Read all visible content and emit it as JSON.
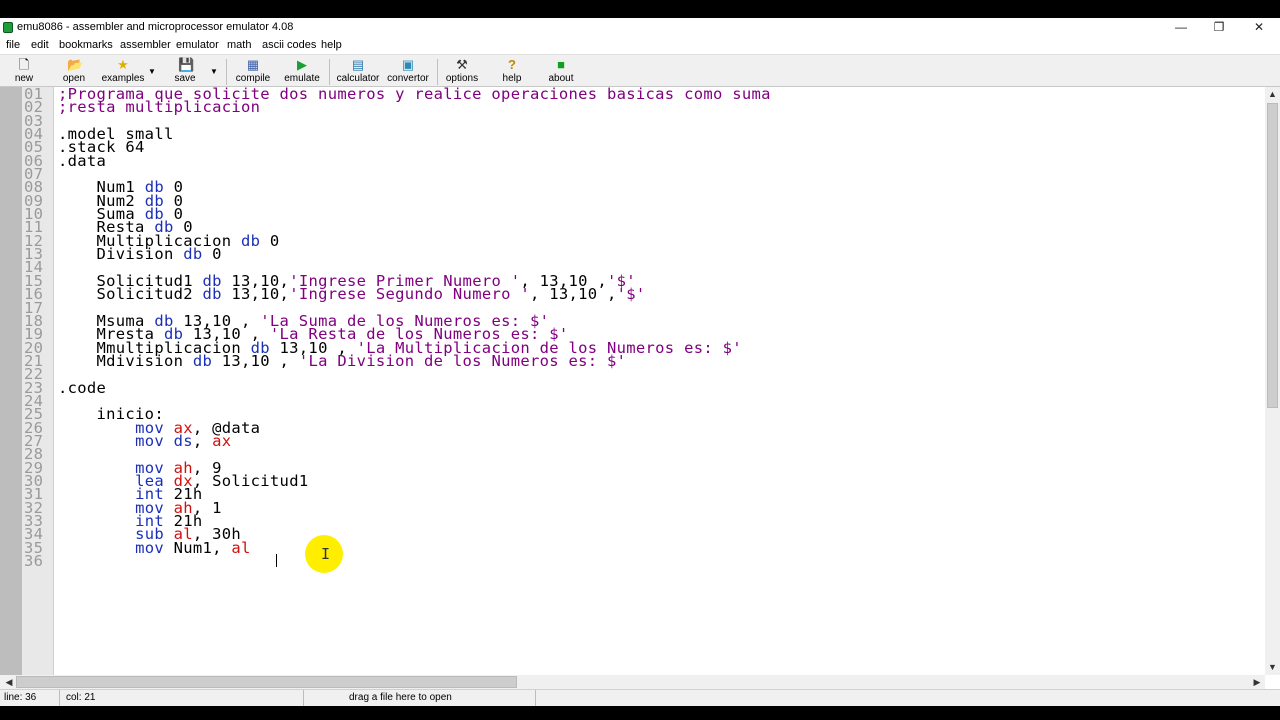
{
  "window": {
    "title": "emu8086 - assembler and microprocessor emulator 4.08",
    "controls": {
      "minimize": "—",
      "maximize": "❐",
      "close": "✕"
    }
  },
  "menu": [
    "file",
    "edit",
    "bookmarks",
    "assembler",
    "emulator",
    "math",
    "ascii codes",
    "help"
  ],
  "toolbar": [
    {
      "label": "new",
      "icon": "new-file-icon",
      "glyph": "🗋"
    },
    {
      "label": "open",
      "icon": "open-folder-icon",
      "glyph": "📂"
    },
    {
      "label": "examples",
      "icon": "star-icon",
      "glyph": "★"
    },
    {
      "label": "save",
      "icon": "floppy-icon",
      "glyph": "💾"
    },
    {
      "label": "compile",
      "icon": "compile-icon",
      "glyph": "▦"
    },
    {
      "label": "emulate",
      "icon": "play-icon",
      "glyph": "▶"
    },
    {
      "label": "calculator",
      "icon": "calculator-icon",
      "glyph": "▤"
    },
    {
      "label": "convertor",
      "icon": "convertor-icon",
      "glyph": "▣"
    },
    {
      "label": "options",
      "icon": "tools-icon",
      "glyph": "⚒"
    },
    {
      "label": "help",
      "icon": "help-icon",
      "glyph": "?"
    },
    {
      "label": "about",
      "icon": "about-icon",
      "glyph": "■"
    }
  ],
  "colors": {
    "comment": "#800080",
    "keyword": "#1a2fb8",
    "register": "#d01010",
    "string": "#800080",
    "highlight": "#ffee00"
  },
  "code_lines": [
    [
      [
        "01",
        "n"
      ],
      [
        ";Programa que solicite dos numeros y realice operaciones basicas como suma",
        "cm"
      ]
    ],
    [
      [
        "02",
        "n"
      ],
      [
        ";resta multiplicacion",
        "cm"
      ]
    ],
    [
      [
        "03",
        "n"
      ]
    ],
    [
      [
        "04",
        "n"
      ],
      [
        ".model small",
        ""
      ]
    ],
    [
      [
        "05",
        "n"
      ],
      [
        ".stack 64",
        ""
      ]
    ],
    [
      [
        "06",
        "n"
      ],
      [
        ".data",
        ""
      ]
    ],
    [
      [
        "07",
        "n"
      ]
    ],
    [
      [
        "08",
        "n"
      ],
      [
        "    Num1 ",
        ""
      ],
      [
        "db",
        "kw"
      ],
      [
        " 0",
        ""
      ]
    ],
    [
      [
        "09",
        "n"
      ],
      [
        "    Num2 ",
        ""
      ],
      [
        "db",
        "kw"
      ],
      [
        " 0",
        ""
      ]
    ],
    [
      [
        "10",
        "n"
      ],
      [
        "    Suma ",
        ""
      ],
      [
        "db",
        "kw"
      ],
      [
        " 0",
        ""
      ]
    ],
    [
      [
        "11",
        "n"
      ],
      [
        "    Resta ",
        ""
      ],
      [
        "db",
        "kw"
      ],
      [
        " 0",
        ""
      ]
    ],
    [
      [
        "12",
        "n"
      ],
      [
        "    Multiplicacion ",
        ""
      ],
      [
        "db",
        "kw"
      ],
      [
        " 0",
        ""
      ]
    ],
    [
      [
        "13",
        "n"
      ],
      [
        "    Division ",
        ""
      ],
      [
        "db",
        "kw"
      ],
      [
        " 0",
        ""
      ]
    ],
    [
      [
        "14",
        "n"
      ]
    ],
    [
      [
        "15",
        "n"
      ],
      [
        "    Solicitud1 ",
        ""
      ],
      [
        "db",
        "kw"
      ],
      [
        " 13,10,",
        ""
      ],
      [
        "'Ingrese Primer Numero '",
        "st"
      ],
      [
        ", 13,10 ,",
        ""
      ],
      [
        "'$'",
        "st"
      ]
    ],
    [
      [
        "16",
        "n"
      ],
      [
        "    Solicitud2 ",
        ""
      ],
      [
        "db",
        "kw"
      ],
      [
        " 13,10,",
        ""
      ],
      [
        "'Ingrese Segundo Numero '",
        "st"
      ],
      [
        ", 13,10 ,",
        ""
      ],
      [
        "'$'",
        "st"
      ]
    ],
    [
      [
        "17",
        "n"
      ]
    ],
    [
      [
        "18",
        "n"
      ],
      [
        "    Msuma ",
        ""
      ],
      [
        "db",
        "kw"
      ],
      [
        " 13,10 , ",
        ""
      ],
      [
        "'La Suma de los Numeros es: $'",
        "st"
      ]
    ],
    [
      [
        "19",
        "n"
      ],
      [
        "    Mresta ",
        ""
      ],
      [
        "db",
        "kw"
      ],
      [
        " 13,10 , ",
        ""
      ],
      [
        "'La Resta de los Numeros es: $'",
        "st"
      ]
    ],
    [
      [
        "20",
        "n"
      ],
      [
        "    Mmultiplicacion ",
        ""
      ],
      [
        "db",
        "kw"
      ],
      [
        " 13,10 , ",
        ""
      ],
      [
        "'La Multiplicacion de los Numeros es: $'",
        "st"
      ]
    ],
    [
      [
        "21",
        "n"
      ],
      [
        "    Mdivision ",
        ""
      ],
      [
        "db",
        "kw"
      ],
      [
        " 13,10 , ",
        ""
      ],
      [
        "'La Division de los Numeros es: $'",
        "st"
      ]
    ],
    [
      [
        "22",
        "n"
      ]
    ],
    [
      [
        "23",
        "n"
      ],
      [
        ".code",
        ""
      ]
    ],
    [
      [
        "24",
        "n"
      ]
    ],
    [
      [
        "25",
        "n"
      ],
      [
        "    inicio:",
        ""
      ]
    ],
    [
      [
        "26",
        "n"
      ],
      [
        "        ",
        ""
      ],
      [
        "mov",
        "kw"
      ],
      [
        " ",
        ""
      ],
      [
        "ax",
        "rg"
      ],
      [
        ", @data",
        ""
      ]
    ],
    [
      [
        "27",
        "n"
      ],
      [
        "        ",
        ""
      ],
      [
        "mov",
        "kw"
      ],
      [
        " ",
        ""
      ],
      [
        "ds",
        "kw"
      ],
      [
        ", ",
        ""
      ],
      [
        "ax",
        "rg"
      ]
    ],
    [
      [
        "28",
        "n"
      ]
    ],
    [
      [
        "29",
        "n"
      ],
      [
        "        ",
        ""
      ],
      [
        "mov",
        "kw"
      ],
      [
        " ",
        ""
      ],
      [
        "ah",
        "rg"
      ],
      [
        ", 9",
        ""
      ]
    ],
    [
      [
        "30",
        "n"
      ],
      [
        "        ",
        ""
      ],
      [
        "lea",
        "kw"
      ],
      [
        " ",
        ""
      ],
      [
        "dx",
        "rg"
      ],
      [
        ", Solicitud1",
        ""
      ]
    ],
    [
      [
        "31",
        "n"
      ],
      [
        "        ",
        ""
      ],
      [
        "int",
        "kw"
      ],
      [
        " 21h",
        ""
      ]
    ],
    [
      [
        "32",
        "n"
      ],
      [
        "        ",
        ""
      ],
      [
        "mov",
        "kw"
      ],
      [
        " ",
        ""
      ],
      [
        "ah",
        "rg"
      ],
      [
        ", 1",
        ""
      ]
    ],
    [
      [
        "33",
        "n"
      ],
      [
        "        ",
        ""
      ],
      [
        "int",
        "kw"
      ],
      [
        " 21h",
        ""
      ]
    ],
    [
      [
        "34",
        "n"
      ],
      [
        "        ",
        ""
      ],
      [
        "sub",
        "kw"
      ],
      [
        " ",
        ""
      ],
      [
        "al",
        "rg"
      ],
      [
        ", 30h",
        ""
      ]
    ],
    [
      [
        "35",
        "n"
      ],
      [
        "        ",
        ""
      ],
      [
        "mov",
        "kw"
      ],
      [
        " Num1, ",
        ""
      ],
      [
        "al",
        "rg"
      ]
    ],
    [
      [
        "36",
        "n"
      ]
    ]
  ],
  "status": {
    "line": "line: 36",
    "col": "col: 21",
    "hint": "drag a file here to open"
  }
}
